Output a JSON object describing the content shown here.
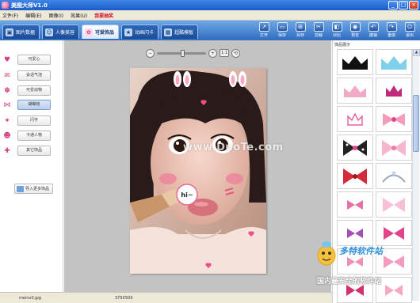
{
  "window": {
    "title": "美图大师V1.0",
    "controls": [
      "_",
      "□",
      "×"
    ]
  },
  "menu": {
    "items": [
      "文件(F)",
      "编辑(E)",
      "图像(I)",
      "效果(U)"
    ],
    "highlight": "我要抽奖"
  },
  "tabs": [
    {
      "label": "图片数据",
      "icon": "▣"
    },
    {
      "label": "人像美容",
      "icon": "☺"
    },
    {
      "label": "可爱饰品",
      "icon": "✿"
    },
    {
      "label": "动画闪卡",
      "icon": "★"
    },
    {
      "label": "超酷模板",
      "icon": "▦"
    }
  ],
  "tools": [
    {
      "label": "打开",
      "icon": "↗"
    },
    {
      "label": "保存",
      "icon": "▭"
    },
    {
      "label": "另存",
      "icon": "⊞"
    },
    {
      "label": "剪裁",
      "icon": "✂"
    },
    {
      "label": "对比",
      "icon": "◧"
    },
    {
      "label": "预览",
      "icon": "◉"
    },
    {
      "label": "撤销",
      "icon": "↶"
    },
    {
      "label": "重做",
      "icon": "↷"
    },
    {
      "label": "退出",
      "icon": "⏻"
    }
  ],
  "categories": [
    {
      "label": "可爱心",
      "icon": "♥"
    },
    {
      "label": "会话气泡",
      "icon": "✉"
    },
    {
      "label": "可爱动物",
      "icon": "✽"
    },
    {
      "label": "蝴蝶结",
      "icon": "⋈"
    },
    {
      "label": "闪字",
      "icon": "✦"
    },
    {
      "label": "卡通人物",
      "icon": "☻"
    },
    {
      "label": "其它饰品",
      "icon": "✚"
    }
  ],
  "import_button": "导入更多饰品",
  "zoom": {
    "zoom_in": "+",
    "zoom_out": "−",
    "actual": "1:1",
    "fit": "⟲",
    "level": 0.52
  },
  "photo_watermark": "www.DuoTe.com",
  "photo_badge": "hi~",
  "stickers": {
    "title": "饰品展示"
  },
  "status": {
    "filename": "meinv0.jpg",
    "size": "375X500"
  },
  "site_watermark": {
    "title": "多特软件站",
    "sub": "国内最安全的软件站",
    "brand": "DuoTe"
  },
  "colors": {
    "title_bar": "#1c5cc9",
    "accent_pink": "#e2438a",
    "canvas_bg": "#c3c3c3"
  }
}
